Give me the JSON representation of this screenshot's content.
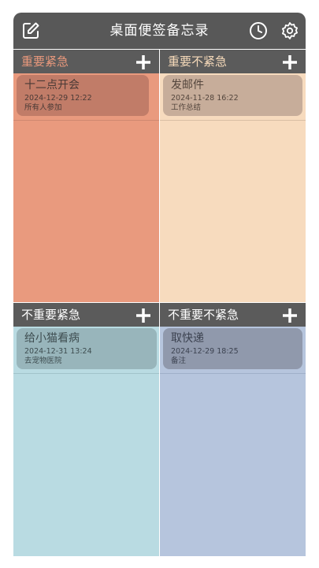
{
  "app": {
    "title": "桌面便签备忘录"
  },
  "quadrants": [
    {
      "label": "重要紧急",
      "label_color": "#e8987c",
      "bg": "#e99a7e",
      "card_bg": "#c17c68",
      "items": [
        {
          "title": "十二点开会",
          "date": "2024-12-29 12:22",
          "note": "所有人参加"
        }
      ]
    },
    {
      "label": "重要不紧急",
      "label_color": "#f5d9b9",
      "bg": "#f7dbbe",
      "card_bg": "#c7ad9a",
      "items": [
        {
          "title": "发邮件",
          "date": "2024-11-28 16:22",
          "note": "工作总结"
        }
      ]
    },
    {
      "label": "不重要紧急",
      "label_color": "#ffffff",
      "bg": "#b9dbe2",
      "card_bg": "#98b5bb",
      "items": [
        {
          "title": "给小猫看病",
          "date": "2024-12-31 13:24",
          "note": "去宠物医院"
        }
      ]
    },
    {
      "label": "不重要不紧急",
      "label_color": "#ffffff",
      "bg": "#b6c5dd",
      "card_bg": "#9099ac",
      "items": [
        {
          "title": "取快递",
          "date": "2024-12-29 18:25",
          "note": "备注"
        }
      ]
    }
  ],
  "icons": {
    "edit": "edit-icon",
    "clock": "clock-icon",
    "settings": "gear-icon",
    "add": "plus-icon"
  }
}
